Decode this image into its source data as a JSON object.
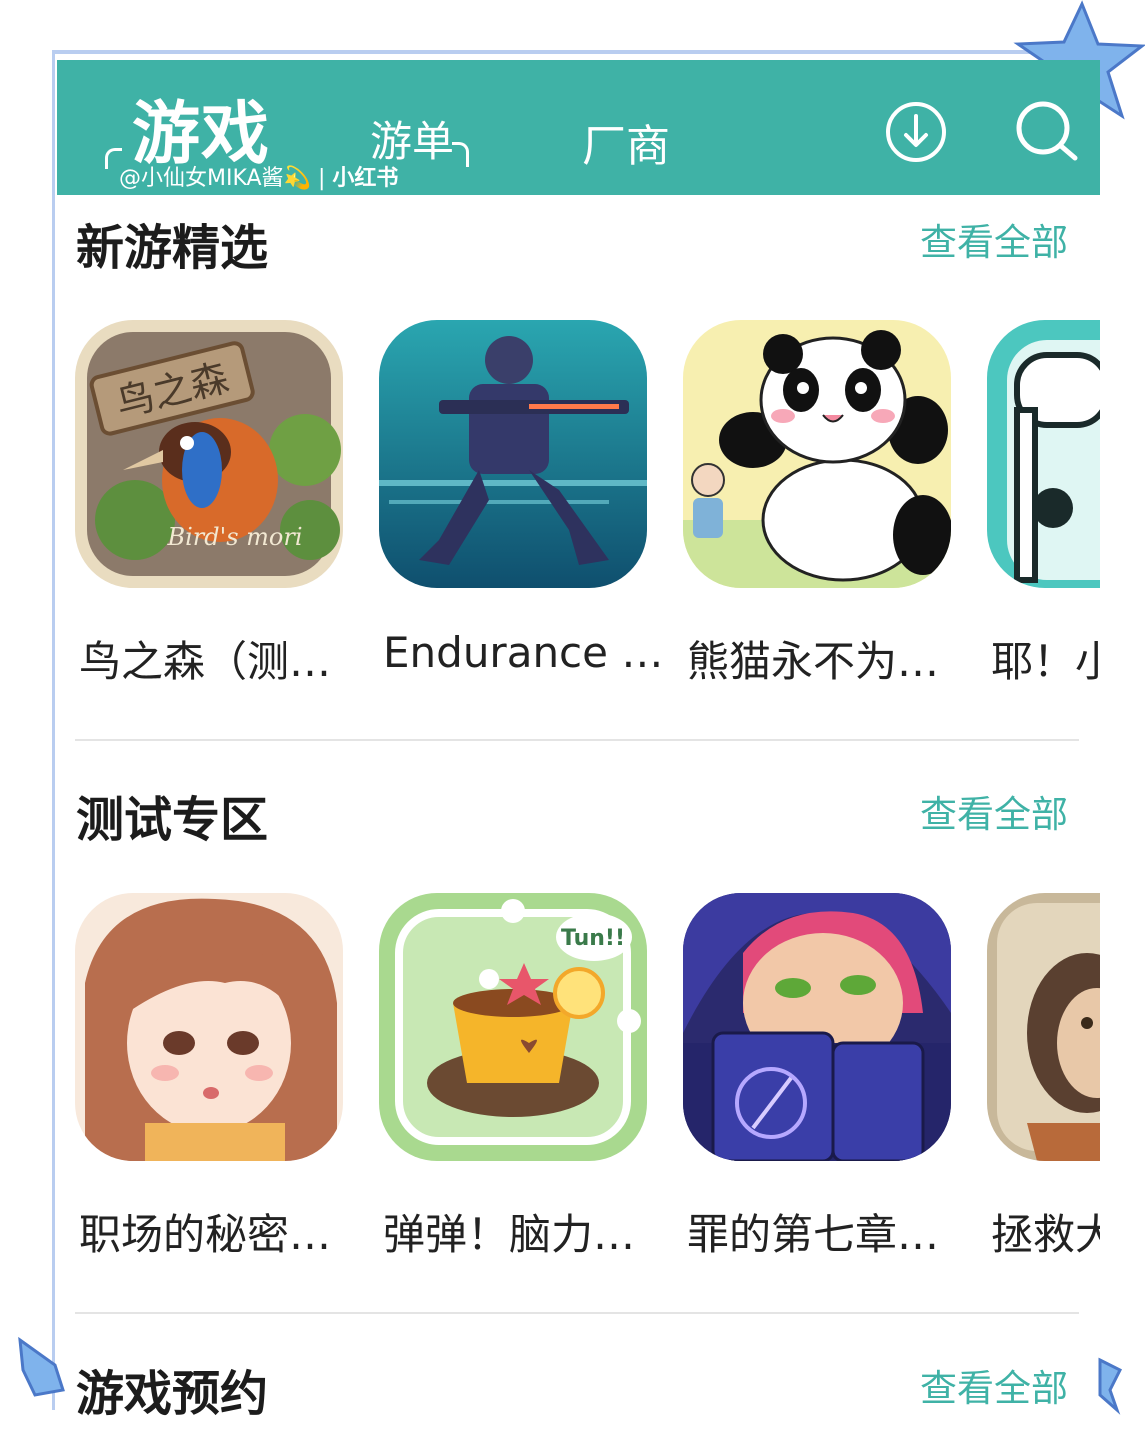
{
  "header": {
    "tabs": [
      {
        "label": "游戏"
      },
      {
        "label": "游单"
      },
      {
        "label": "厂商"
      }
    ],
    "watermark_user": "@小仙女MIKA酱💫",
    "watermark_brand": "小红书",
    "icons": [
      "download-icon",
      "search-icon"
    ],
    "color": "#3fb2a6"
  },
  "sections": [
    {
      "title": "新游精选",
      "view_all": "查看全部",
      "games": [
        {
          "name": "鸟之森（测…"
        },
        {
          "name": "Endurance …"
        },
        {
          "name": "熊猫永不为…"
        },
        {
          "name": "耶！小"
        }
      ]
    },
    {
      "title": "测试专区",
      "view_all": "查看全部",
      "games": [
        {
          "name": "职场的秘密…"
        },
        {
          "name": "弹弹！脑力…"
        },
        {
          "name": "罪的第七章…"
        },
        {
          "name": "拯救大"
        }
      ]
    },
    {
      "title": "游戏预约",
      "view_all": "查看全部"
    }
  ],
  "icon_texts": {
    "birds_sign": "鸟之森",
    "birds_caption": "Bird's mori",
    "tun_bubble": "Tun!!"
  },
  "accent_color": "#3fb2a6"
}
